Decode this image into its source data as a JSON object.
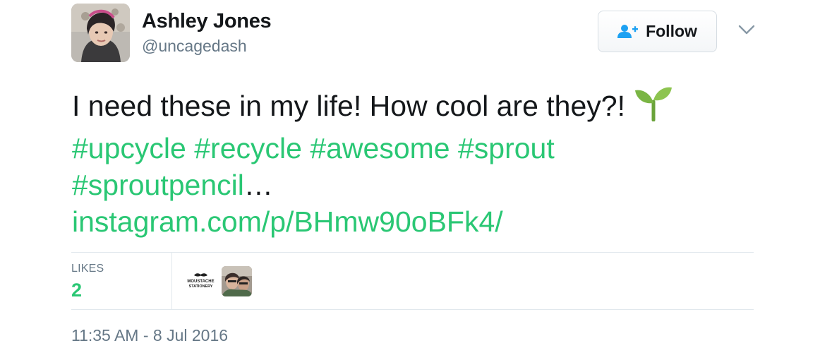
{
  "author": {
    "display_name": "Ashley Jones",
    "handle": "@uncagedash"
  },
  "follow_button": {
    "label": "Follow"
  },
  "tweet": {
    "text_line1": "I need these in my life! How cool are they?!",
    "emoji": "seedling-emoji",
    "hashtags_line2": [
      "#upcycle",
      "#recycle",
      "#awesome",
      "#sprout"
    ],
    "hashtag_line3": "#sproutpencil",
    "ellipsis": "…",
    "link": "instagram.com/p/BHmw90oBFk4/"
  },
  "stats": {
    "likes_label": "LIKES",
    "likes_count": "2",
    "likers": [
      {
        "name": "moustache-stationery-avatar",
        "logo_text_1": "MOUSTACHE",
        "logo_text_2": "STATIONERY"
      },
      {
        "name": "user-photo-avatar"
      }
    ]
  },
  "timestamp": "11:35 AM - 8 Jul 2016",
  "colors": {
    "accent": "#2ac774",
    "text": "#14171a",
    "muted": "#657786",
    "border": "#e1e8ed"
  }
}
